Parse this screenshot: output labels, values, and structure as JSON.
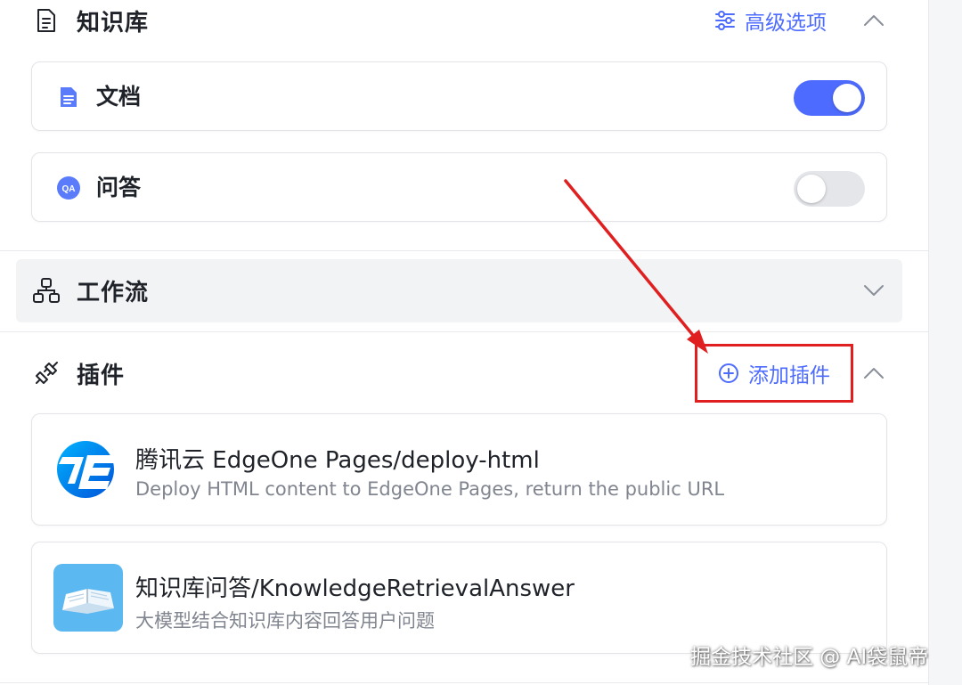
{
  "knowledge": {
    "title": "知识库",
    "advanced_label": "高级选项",
    "items": [
      {
        "label": "文档",
        "enabled": true
      },
      {
        "label": "问答",
        "enabled": false
      }
    ]
  },
  "workflow": {
    "title": "工作流"
  },
  "plugins": {
    "title": "插件",
    "add_label": "添加插件",
    "items": [
      {
        "title": "腾讯云 EdgeOne Pages/deploy-html",
        "description": "Deploy HTML content to EdgeOne Pages, return the public URL",
        "icon": "edgeone-logo-icon"
      },
      {
        "title": "知识库问答/KnowledgeRetrievalAnswer",
        "description": "大模型结合知识库内容回答用户问题",
        "icon": "open-book-icon"
      }
    ]
  },
  "watermark": "掘金技术社区 @ AI袋鼠帝",
  "colors": {
    "accent": "#4d6bfe",
    "highlight": "#e02020",
    "muted": "#80858f"
  }
}
